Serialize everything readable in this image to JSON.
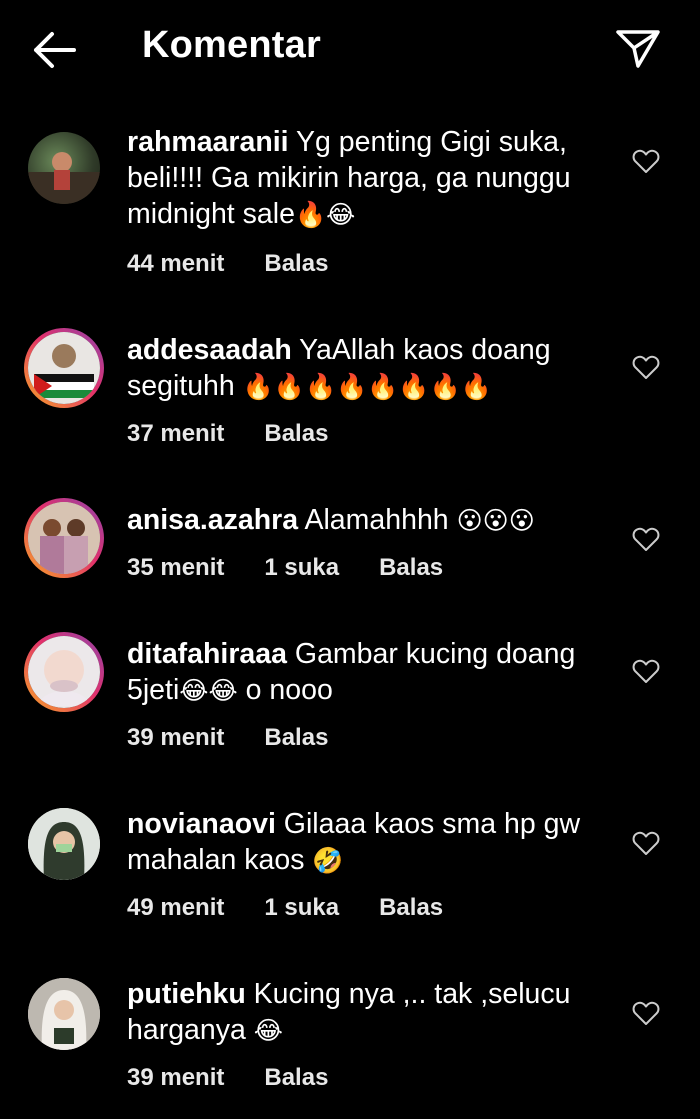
{
  "header": {
    "title": "Komentar"
  },
  "comments": [
    {
      "username": "rahmaaranii",
      "text": "Yg penting Gigi suka, beli!!!! Ga mikirin harga, ga nunggu midnight sale",
      "emoji": "🔥😂",
      "time": "44 menit",
      "likes": "",
      "reply": "Balas"
    },
    {
      "username": "addesaadah",
      "text": "YaAllah kaos doang segituhh",
      "emoji": "🔥🔥🔥🔥🔥🔥🔥🔥",
      "time": "37 menit",
      "likes": "",
      "reply": "Balas"
    },
    {
      "username": "anisa.azahra",
      "text": "Alamahhhh",
      "emoji": "😮😮😮",
      "time": "35 menit",
      "likes": "1 suka",
      "reply": "Balas"
    },
    {
      "username": "ditafahiraaa",
      "text": "Gambar kucing doang 5jeti",
      "emoji": "😂😂",
      "tail": "o nooo",
      "time": "39 menit",
      "likes": "",
      "reply": "Balas"
    },
    {
      "username": "novianaovi",
      "text": "Gilaaa kaos sma hp gw mahalan kaos",
      "emoji": "🤣",
      "time": "49 menit",
      "likes": "1 suka",
      "reply": "Balas"
    },
    {
      "username": "putiehku",
      "text": "Kucing nya ,.. tak ,selucu harganya",
      "emoji": "😂",
      "time": "39 menit",
      "likes": "",
      "reply": "Balas"
    }
  ],
  "icons": {
    "back": "arrow-left-icon",
    "send": "paper-plane-icon",
    "like": "heart-outline-icon"
  },
  "colors": {
    "background": "#000000",
    "text": "#ffffff",
    "story_ring_start": "#f9a825",
    "story_ring_end": "#8e44ad"
  }
}
